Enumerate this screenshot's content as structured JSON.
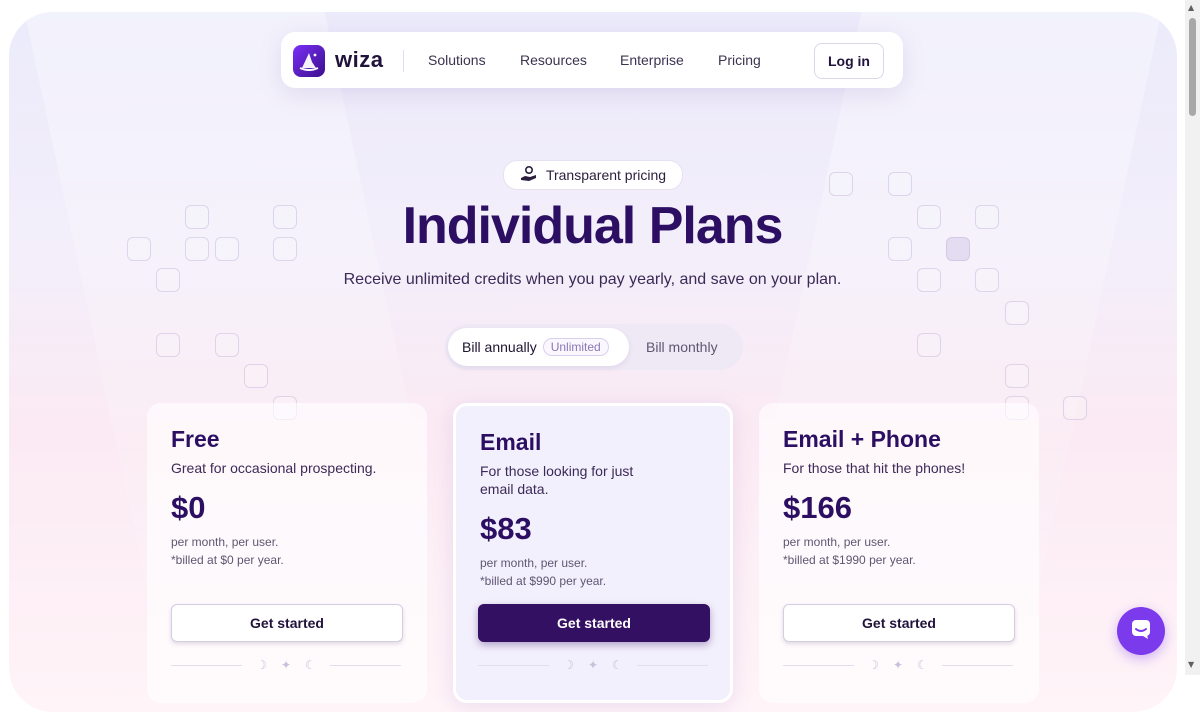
{
  "nav": {
    "brand": "wiza",
    "links": [
      "Solutions",
      "Resources",
      "Enterprise",
      "Pricing"
    ],
    "login_label": "Log in"
  },
  "hero": {
    "badge": "Transparent pricing",
    "title": "Individual Plans",
    "subtitle": "Receive unlimited credits when you pay yearly, and save on your plan."
  },
  "billing_toggle": {
    "annual_label": "Bill annually",
    "annual_pill": "Unlimited",
    "monthly_label": "Bill monthly",
    "selected": "annual"
  },
  "plans": [
    {
      "name": "Free",
      "description": "Great for occasional prospecting.",
      "price": "$0",
      "period": "per month, per user.",
      "billed": "*billed at $0 per year.",
      "cta": "Get started",
      "highlighted": false
    },
    {
      "name": "Email",
      "description": "For those looking for just email data.",
      "price": "$83",
      "period": "per month, per user.",
      "billed": "*billed at $990 per year.",
      "cta": "Get started",
      "highlighted": true
    },
    {
      "name": "Email + Phone",
      "description": "For those that hit the phones!",
      "price": "$166",
      "period": "per month, per user.",
      "billed": "*billed at $1990 per year.",
      "cta": "Get started",
      "highlighted": false
    }
  ],
  "colors": {
    "brand_dark": "#2c0f62",
    "primary_button": "#341063",
    "chat_button": "#7c3aed"
  },
  "icons": {
    "logo": "wizard-hat-icon",
    "badge": "hand-coin-icon",
    "chat": "chat-bubble-icon"
  }
}
